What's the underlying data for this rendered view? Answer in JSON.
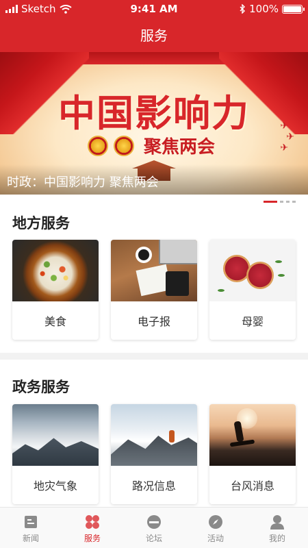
{
  "status": {
    "carrier": "Sketch",
    "time": "9:41 AM",
    "battery": "100%"
  },
  "nav": {
    "title": "服务"
  },
  "banner": {
    "headline": "中国影响力",
    "subline": "聚焦两会",
    "caption": "时政：中国影响力 聚焦两会",
    "pager": {
      "count": 4,
      "active": 1
    }
  },
  "local_services": {
    "title": "地方服务",
    "items": [
      {
        "label": "美食"
      },
      {
        "label": "电子报"
      },
      {
        "label": "母婴"
      }
    ]
  },
  "gov_services": {
    "title": "政务服务",
    "items": [
      {
        "label": "地灾气象"
      },
      {
        "label": "路况信息"
      },
      {
        "label": "台风消息"
      }
    ]
  },
  "tabbar": {
    "active_color": "#d8262a",
    "inactive_color": "#8a8a8a",
    "tabs": [
      {
        "label": "新闻",
        "icon": "news-icon"
      },
      {
        "label": "服务",
        "icon": "services-icon"
      },
      {
        "label": "论坛",
        "icon": "forum-icon"
      },
      {
        "label": "活动",
        "icon": "activity-compass-icon"
      },
      {
        "label": "我的",
        "icon": "profile-icon"
      }
    ]
  },
  "colors": {
    "brand_red": "#d8262a"
  }
}
